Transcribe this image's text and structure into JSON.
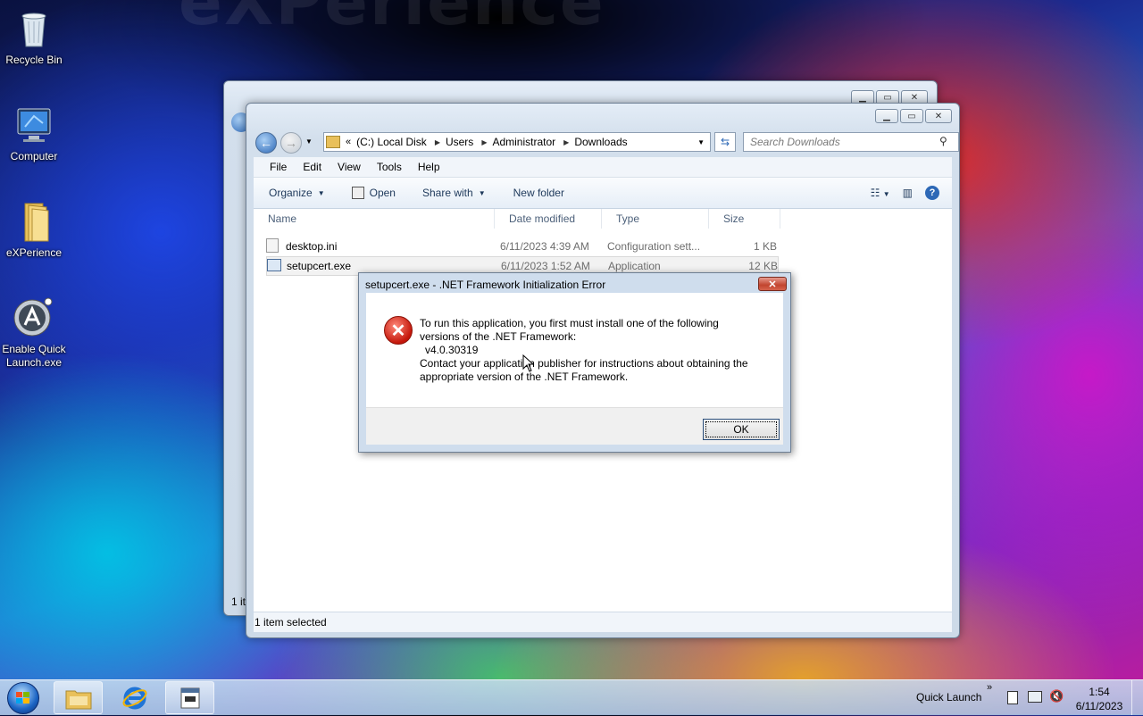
{
  "desktop": {
    "icons": [
      {
        "label": "Recycle Bin"
      },
      {
        "label": "Computer"
      },
      {
        "label": "eXPerience"
      },
      {
        "label": "Enable Quick Launch.exe"
      }
    ]
  },
  "back_window": {
    "status_text": "1 it"
  },
  "explorer": {
    "breadcrumb": [
      "(C:) Local Disk",
      "Users",
      "Administrator",
      "Downloads"
    ],
    "search_placeholder": "Search Downloads",
    "menu": [
      "File",
      "Edit",
      "View",
      "Tools",
      "Help"
    ],
    "toolbar": {
      "organize": "Organize",
      "open": "Open",
      "share_with": "Share with",
      "new_folder": "New folder"
    },
    "columns": [
      "Name",
      "Date modified",
      "Type",
      "Size"
    ],
    "files": [
      {
        "name": "desktop.ini",
        "date": "6/11/2023 4:39 AM",
        "type": "Configuration sett...",
        "size": "1 KB"
      },
      {
        "name": "setupcert.exe",
        "date": "6/11/2023 1:52 AM",
        "type": "Application",
        "size": "12 KB"
      }
    ],
    "status": "1 item selected"
  },
  "dialog": {
    "title": "setupcert.exe - .NET Framework Initialization Error",
    "line1": "To run this application, you first must install one of the following",
    "line2": "versions of the .NET Framework:",
    "line3": "v4.0.30319",
    "line4": "Contact your application publisher for instructions about obtaining the",
    "line5": "appropriate version of the .NET Framework.",
    "ok": "OK"
  },
  "taskbar": {
    "quick_launch": "Quick Launch",
    "time": "1:54",
    "date": "6/11/2023"
  }
}
